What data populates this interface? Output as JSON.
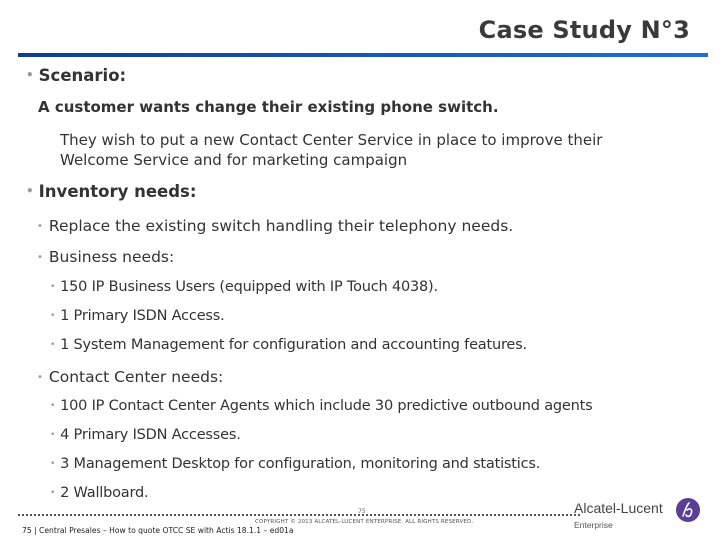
{
  "slide": {
    "title": "Case Study N°3",
    "bullet_glyph": "•",
    "scenario": {
      "heading": "Scenario:",
      "subheading": "A customer wants change their existing phone switch.",
      "description": "They wish to put a new Contact Center Service in place to improve their Welcome Service and for marketing campaign"
    },
    "inventory": {
      "heading": "Inventory needs:",
      "items": [
        {
          "text": "Replace the existing switch handling their telephony needs."
        },
        {
          "text": "Business needs:",
          "children": [
            "150 IP Business Users (equipped with IP Touch 4038).",
            "1  Primary ISDN Access.",
            "1 System Management for configuration and accounting features."
          ]
        },
        {
          "text": "Contact Center needs:",
          "children": [
            "100 IP Contact Center Agents which include 30 predictive outbound agents",
            "4  Primary ISDN Accesses.",
            "3 Management Desktop for configuration, monitoring and statistics.",
            "2 Wallboard."
          ]
        }
      ]
    }
  },
  "footer": {
    "page_marker": "75",
    "copyright": "COPYRIGHT © 2013 ALCATEL-LUCENT ENTERPRISE. ALL RIGHTS RESERVED.",
    "text": "75 | Central Presales – How to quote OTCC SE with Actis 18.1.1 – ed01a"
  },
  "logo": {
    "name": "Alcatel-Lucent",
    "sub": "Enterprise",
    "color": "#5b3e96"
  },
  "colors": {
    "title_rule_start": "#0d3f8f",
    "title_rule_end": "#1f6fd6",
    "text": "#333333",
    "bullet": "#9a9a9a"
  }
}
